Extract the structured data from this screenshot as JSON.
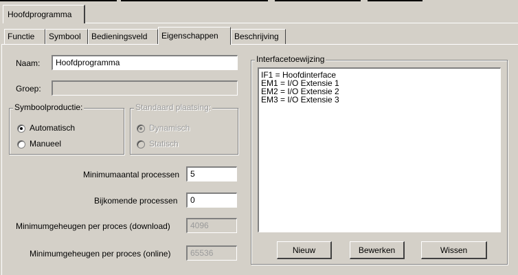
{
  "window": {
    "tab_label": "Hoofdprogramma"
  },
  "tabs": [
    {
      "label": "Functie"
    },
    {
      "label": "Symbool"
    },
    {
      "label": "Bedieningsveld"
    },
    {
      "label": "Eigenschappen",
      "active": true
    },
    {
      "label": "Beschrijving"
    }
  ],
  "form": {
    "name_label": "Naam:",
    "name_value": "Hoofdprogramma",
    "group_label": "Groep:",
    "group_value": "",
    "min_processes_label": "Minimumaantal processen",
    "min_processes_value": "5",
    "extra_processes_label": "Bijkomende processen",
    "extra_processes_value": "0",
    "min_memory_download_label": "Minimumgeheugen per proces (download)",
    "min_memory_download_value": "4096",
    "min_memory_online_label": "Minimumgeheugen per proces (online)",
    "min_memory_online_value": "65536"
  },
  "symbol_production": {
    "legend": "Symboolproductie:",
    "options": [
      {
        "label": "Automatisch",
        "selected": true
      },
      {
        "label": "Manueel",
        "selected": false
      }
    ]
  },
  "standard_placement": {
    "legend": "Standaard plaatsing:",
    "options": [
      {
        "label": "Dynamisch",
        "selected": true
      },
      {
        "label": "Statisch",
        "selected": false
      }
    ]
  },
  "interface": {
    "legend": "Interfacetoewijzing",
    "items": [
      "IF1 = Hoofdinterface",
      "EM1 = I/O Extensie 1",
      "EM2 = I/O Extensie 2",
      "EM3 = I/O Extensie 3"
    ],
    "buttons": {
      "new": "Nieuw",
      "edit": "Bewerken",
      "delete": "Wissen"
    }
  }
}
